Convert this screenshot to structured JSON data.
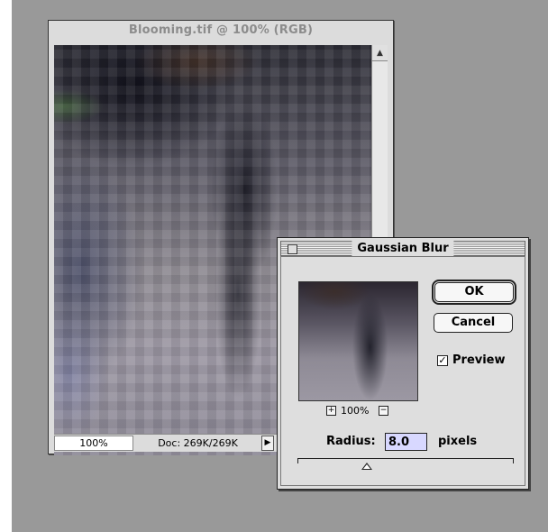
{
  "document_window": {
    "title": "Blooming.tif @ 100% (RGB)",
    "zoom": "100%",
    "doc_size": "Doc: 269K/269K",
    "status_menu_arrow": "▶",
    "scroll_up_arrow": "▲"
  },
  "dialog": {
    "title": "Gaussian Blur",
    "ok_label": "OK",
    "cancel_label": "Cancel",
    "preview_label": "Preview",
    "preview_checked": true,
    "preview_check_mark": "✓",
    "zoom_level": "100%",
    "zoom_plus": "+",
    "zoom_minus": "−",
    "radius_label": "Radius:",
    "radius_value": "8.0",
    "radius_unit": "pixels"
  }
}
